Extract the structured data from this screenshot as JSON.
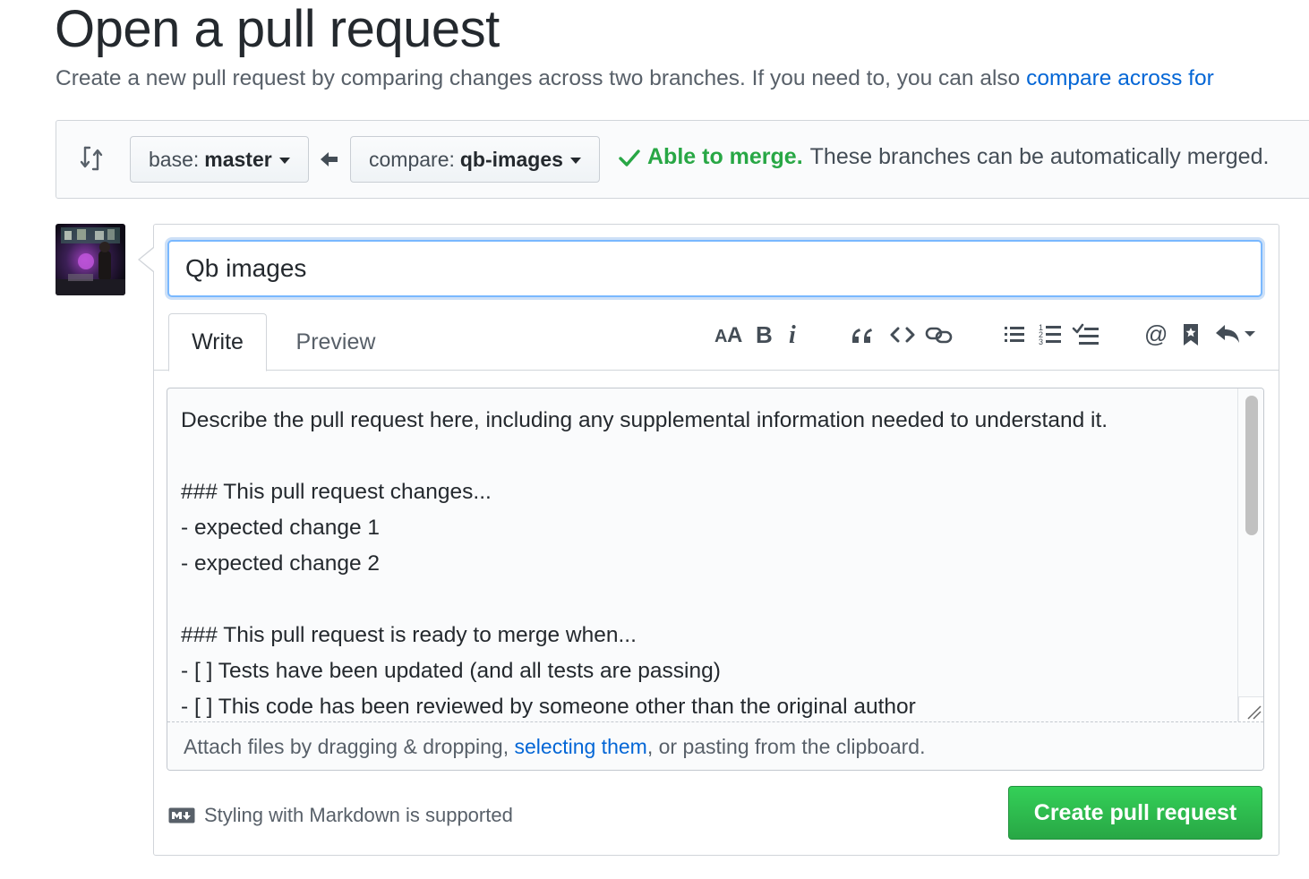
{
  "page": {
    "title": "Open a pull request",
    "subtitle_text": "Create a new pull request by comparing changes across two branches. If you need to, you can also ",
    "subtitle_link": "compare across for"
  },
  "compare": {
    "base_label": "base:",
    "base_value": "master",
    "compare_label": "compare:",
    "compare_value": "qb-images",
    "merge_ok": "Able to merge.",
    "merge_desc": "These branches can be automatically merged."
  },
  "form": {
    "title_value": "Qb images",
    "tabs": [
      {
        "label": "Write",
        "active": true
      },
      {
        "label": "Preview",
        "active": false
      }
    ],
    "toolbar": {
      "header": "header-icon",
      "bold": "bold-icon",
      "italic": "italic-icon",
      "quote": "quote-icon",
      "code": "code-icon",
      "link": "link-icon",
      "ul": "unordered-list-icon",
      "ol": "ordered-list-icon",
      "tasks": "task-list-icon",
      "mention": "mention-icon",
      "reference": "bookmark-icon",
      "reply": "saved-reply-icon"
    },
    "body_lines": [
      "Describe the pull request here, including any supplemental information needed to understand it.",
      "",
      "### This pull request changes...",
      "- expected change 1",
      "- expected change 2",
      "",
      "### This pull request is ready to merge when...",
      "- [ ] Tests have been updated (and all tests are passing)",
      "- [ ] This code has been reviewed by someone other than the original author"
    ],
    "attach_pre": "Attach files by dragging & dropping, ",
    "attach_link": "selecting them",
    "attach_post": ", or pasting from the clipboard.",
    "markdown_note": "Styling with Markdown is supported",
    "submit_label": "Create pull request"
  },
  "colors": {
    "link": "#0366d6",
    "success": "#28a745",
    "focus": "#79b8ff"
  }
}
